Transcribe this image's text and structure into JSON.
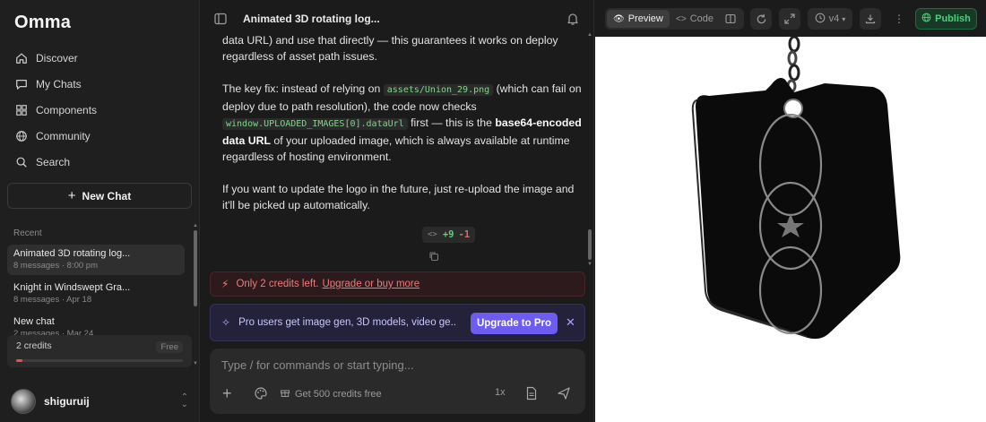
{
  "app": {
    "brand": "Omma"
  },
  "sidebar": {
    "nav": [
      {
        "label": "Discover",
        "icon": "home-icon"
      },
      {
        "label": "My Chats",
        "icon": "chat-bubble-icon"
      },
      {
        "label": "Components",
        "icon": "grid-icon"
      },
      {
        "label": "Community",
        "icon": "globe-icon"
      },
      {
        "label": "Search",
        "icon": "search-icon"
      }
    ],
    "new_chat": "New Chat",
    "recent_label": "Recent",
    "recent": [
      {
        "title": "Animated 3D rotating log...",
        "meta": "8 messages · 8:00 pm"
      },
      {
        "title": "Knight in Windswept Gra...",
        "meta": "8 messages · Apr 18"
      },
      {
        "title": "New chat",
        "meta": "2 messages · Mar 24"
      }
    ],
    "credits": {
      "label": "2 credits",
      "badge": "Free",
      "used_fraction": 0.04
    },
    "user": {
      "name": "shiguruij"
    }
  },
  "chat": {
    "title": "Animated 3D rotating log...",
    "messages": {
      "p1": "data URL) and use that directly — this guarantees it works on deploy regardless of asset path issues.",
      "p2_a": "The key fix: instead of relying on ",
      "p2_code1": "assets/Union_29.png",
      "p2_b": " (which can fail on deploy due to path resolution), the code now checks ",
      "p2_code2": "window.UPLOADED_IMAGES[0].dataUrl",
      "p2_c": " first — this is the ",
      "p2_bold": "base64-encoded data URL",
      "p2_d": " of your uploaded image, which is always available at runtime regardless of hosting environment.",
      "p3": "If you want to update the logo in the future, just re-upload the image and it'll be picked up automatically."
    },
    "diff": {
      "added": "+9",
      "removed": "-1"
    },
    "warning": {
      "text": "Only 2 credits left.",
      "link": "Upgrade or buy more"
    },
    "promo": {
      "text": "Pro users get image gen, 3D models, video ge...",
      "button": "Upgrade to Pro"
    },
    "composer": {
      "placeholder": "Type / for commands or start typing...",
      "credits_offer": "Get 500 credits free",
      "speed": "1x"
    }
  },
  "preview": {
    "tabs": [
      {
        "label": "Preview",
        "active": true
      },
      {
        "label": "Code",
        "active": false
      }
    ],
    "version": "v4",
    "publish": "Publish",
    "colors": {
      "accent": "#6d5cf0",
      "publish": "#49d17e",
      "warning": "#f07a7a"
    }
  }
}
